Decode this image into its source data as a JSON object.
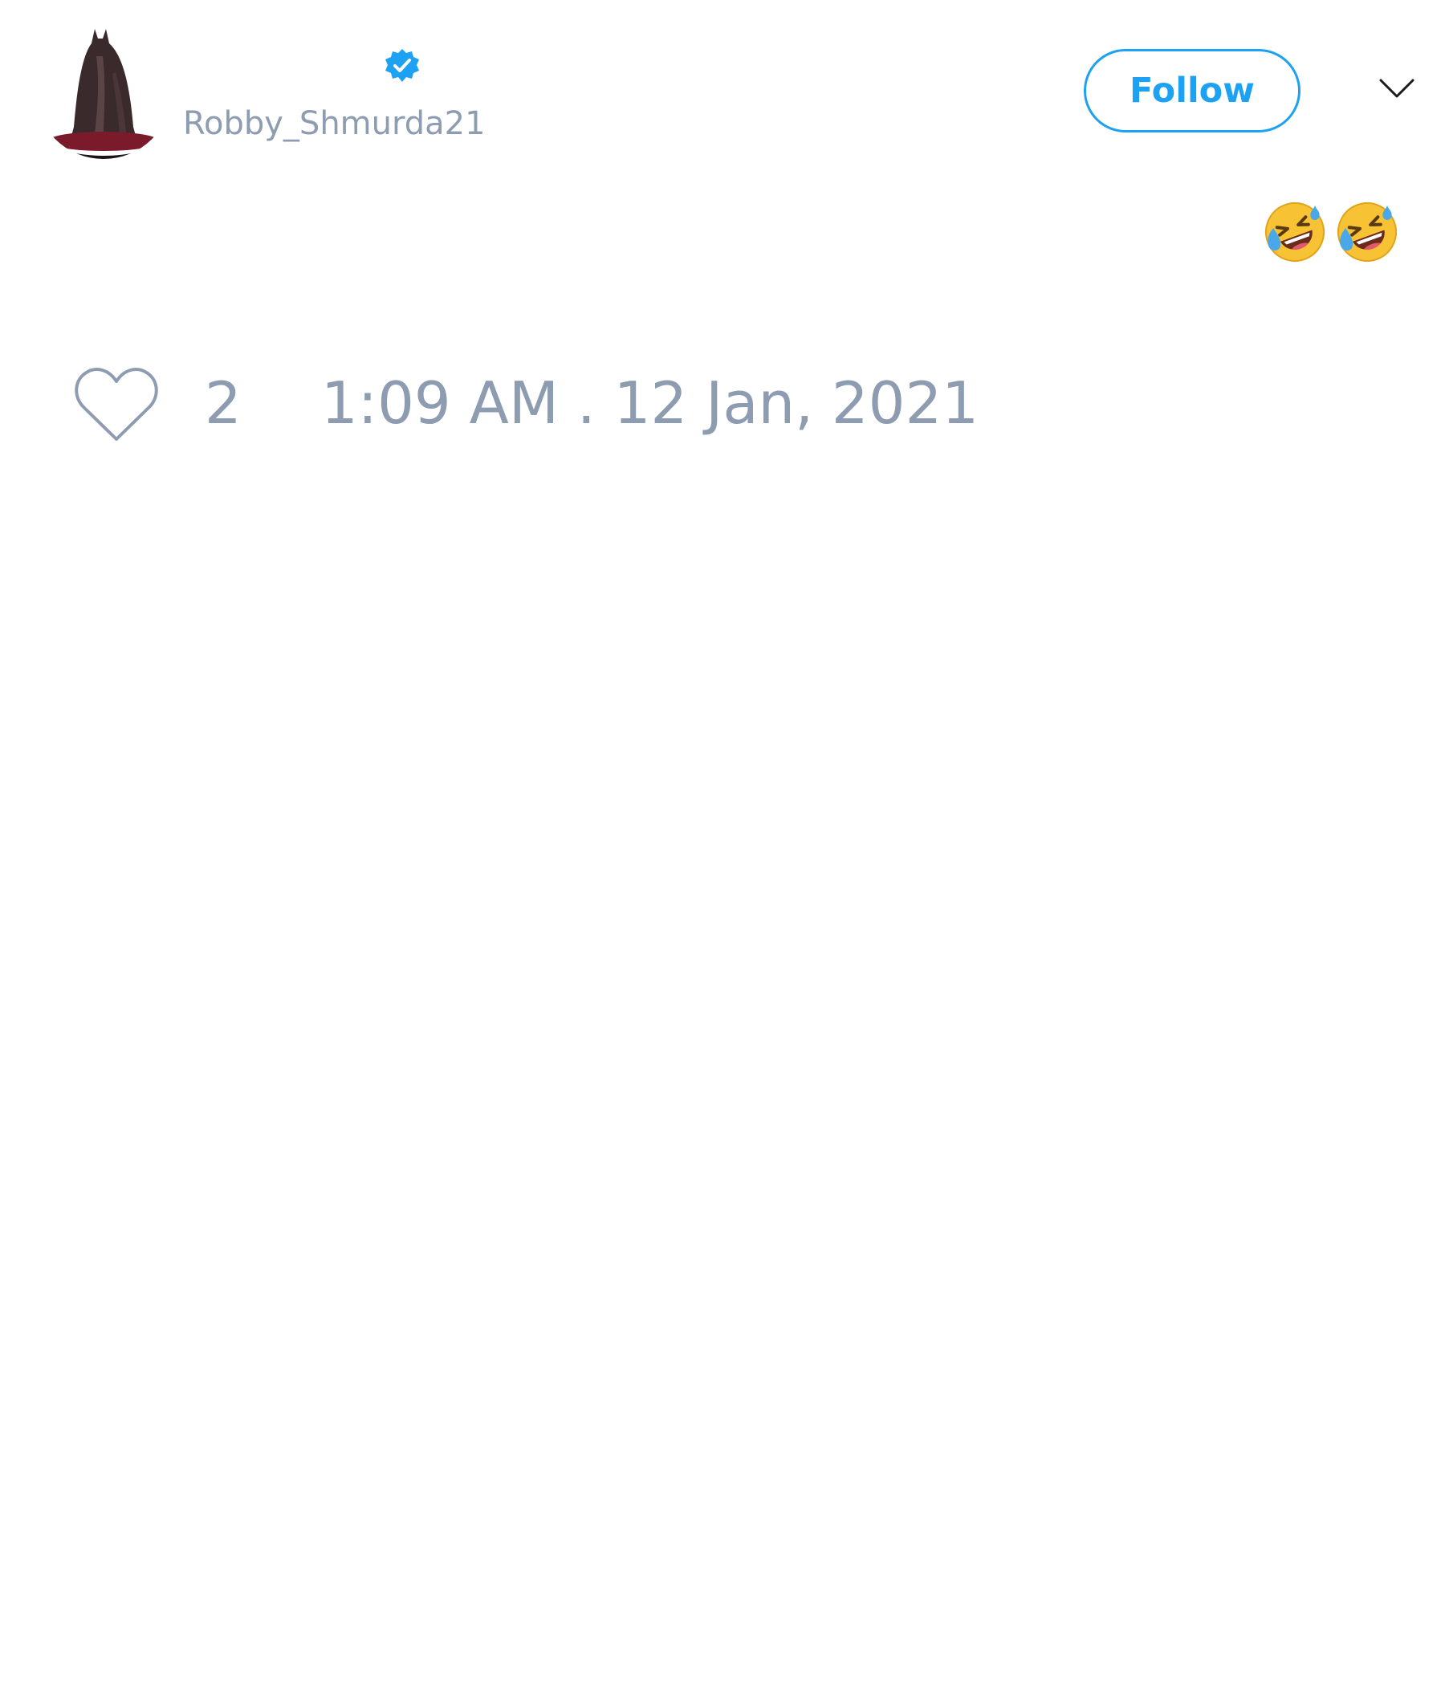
{
  "tweet": {
    "handle": "Robby_Shmurda21",
    "follow_label": "Follow",
    "text_emojis": [
      "rolling-on-the-floor-laughing",
      "rolling-on-the-floor-laughing"
    ],
    "like_count": "2",
    "timestamp": "1:09 AM . 12 Jan, 2021"
  },
  "icons": {
    "verified": "verified-badge-icon",
    "caret": "chevron-down-icon",
    "like": "heart-icon"
  },
  "colors": {
    "accent": "#1da1f2",
    "muted_text": "#8d9cb0"
  }
}
